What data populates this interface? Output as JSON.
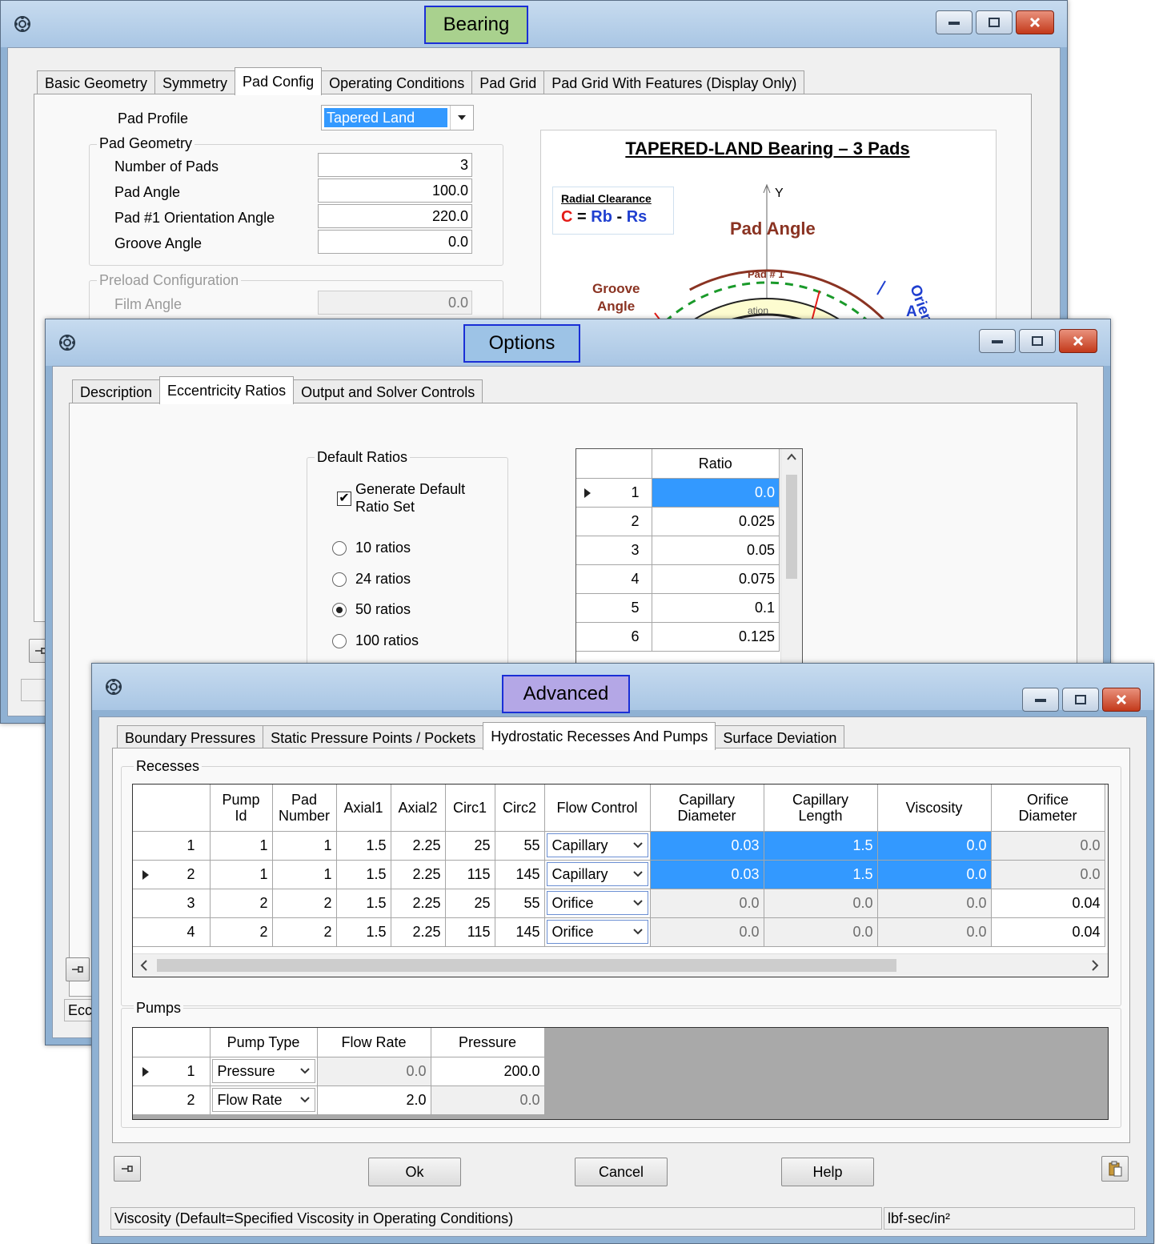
{
  "bearing": {
    "title": "Bearing",
    "tabs": [
      "Basic Geometry",
      "Symmetry",
      "Pad Config",
      "Operating Conditions",
      "Pad Grid",
      "Pad Grid With Features (Display Only)"
    ],
    "pad_profile_label": "Pad Profile",
    "pad_profile_value": "Tapered Land",
    "pad_geometry_caption": "Pad Geometry",
    "number_of_pads_label": "Number of Pads",
    "number_of_pads_value": "3",
    "pad_angle_label": "Pad Angle",
    "pad_angle_value": "100.0",
    "orientation_label": "Pad #1 Orientation Angle",
    "orientation_value": "220.0",
    "groove_label": "Groove Angle",
    "groove_value": "0.0",
    "preload_caption": "Preload Configuration",
    "film_angle_label": "Film Angle",
    "film_angle_value": "0.0",
    "diagram": {
      "title": "TAPERED-LAND Bearing – 3 Pads",
      "radial_clearance": "Radial Clearance",
      "c": "C",
      "eq": "=",
      "rb": "Rb",
      "minus": "-",
      "rs": "Rs",
      "y_axis": "Y",
      "pad_angle": "Pad Angle",
      "groove": "Groove",
      "angle": "Angle",
      "pad1": "Pad # 1",
      "orien": "Orien",
      "a": "A",
      "ation": "ation"
    },
    "status_left": ""
  },
  "options": {
    "title": "Options",
    "tabs": [
      "Description",
      "Eccentricity Ratios",
      "Output and Solver Controls"
    ],
    "default_ratios_caption": "Default Ratios",
    "generate_label_1": "Generate Default",
    "generate_label_2": "Ratio Set",
    "radios": [
      "10 ratios",
      "24 ratios",
      "50 ratios",
      "100 ratios"
    ],
    "selected_radio": 2,
    "ratio_header": "Ratio",
    "ratios": [
      {
        "row": "1",
        "value": "0.0"
      },
      {
        "row": "2",
        "value": "0.025"
      },
      {
        "row": "3",
        "value": "0.05"
      },
      {
        "row": "4",
        "value": "0.075"
      },
      {
        "row": "5",
        "value": "0.1"
      },
      {
        "row": "6",
        "value": "0.125"
      }
    ],
    "status_left": "Ecc"
  },
  "advanced": {
    "title": "Advanced",
    "tabs": [
      "Boundary Pressures",
      "Static Pressure Points / Pockets",
      "Hydrostatic Recesses And Pumps",
      "Surface Deviation"
    ],
    "recesses_caption": "Recesses",
    "recess_headers": {
      "pump_id_1": "Pump",
      "pump_id_2": "Id",
      "pad_number_1": "Pad",
      "pad_number_2": "Number",
      "axial1": "Axial1",
      "axial2": "Axial2",
      "circ1": "Circ1",
      "circ2": "Circ2",
      "flow_control": "Flow Control",
      "cap_diam_1": "Capillary",
      "cap_diam_2": "Diameter",
      "cap_len_1": "Capillary",
      "cap_len_2": "Length",
      "viscosity": "Viscosity",
      "orifice_1": "Orifice",
      "orifice_2": "Diameter"
    },
    "recesses": [
      {
        "row": "1",
        "pump_id": "1",
        "pad_number": "1",
        "axial1": "1.5",
        "axial2": "2.25",
        "circ1": "25",
        "circ2": "55",
        "flow_control": "Capillary",
        "cap_diam": "0.03",
        "cap_len": "1.5",
        "viscosity": "0.0",
        "orifice": "0.0"
      },
      {
        "row": "2",
        "pump_id": "1",
        "pad_number": "1",
        "axial1": "1.5",
        "axial2": "2.25",
        "circ1": "115",
        "circ2": "145",
        "flow_control": "Capillary",
        "cap_diam": "0.03",
        "cap_len": "1.5",
        "viscosity": "0.0",
        "orifice": "0.0"
      },
      {
        "row": "3",
        "pump_id": "2",
        "pad_number": "2",
        "axial1": "1.5",
        "axial2": "2.25",
        "circ1": "25",
        "circ2": "55",
        "flow_control": "Orifice",
        "cap_diam": "0.0",
        "cap_len": "0.0",
        "viscosity": "0.0",
        "orifice": "0.04"
      },
      {
        "row": "4",
        "pump_id": "2",
        "pad_number": "2",
        "axial1": "1.5",
        "axial2": "2.25",
        "circ1": "115",
        "circ2": "145",
        "flow_control": "Orifice",
        "cap_diam": "0.0",
        "cap_len": "0.0",
        "viscosity": "0.0",
        "orifice": "0.04"
      }
    ],
    "pumps_caption": "Pumps",
    "pump_headers": {
      "pump_type": "Pump Type",
      "flow_rate": "Flow Rate",
      "pressure": "Pressure"
    },
    "pumps": [
      {
        "row": "1",
        "pump_type": "Pressure",
        "flow_rate": "0.0",
        "pressure": "200.0"
      },
      {
        "row": "2",
        "pump_type": "Flow Rate",
        "flow_rate": "2.0",
        "pressure": "0.0"
      }
    ],
    "ok_label": "Ok",
    "cancel_label": "Cancel",
    "help_label": "Help",
    "status_text": "Viscosity (Default=Specified Viscosity in Operating Conditions)",
    "status_units": "lbf-sec/in²"
  },
  "icons": {
    "app": "bearing-app-icon",
    "pin": "pin-icon",
    "paste": "paste-icon",
    "row_pointer": "row-pointer-icon",
    "dropdown": "chevron-down-icon"
  }
}
